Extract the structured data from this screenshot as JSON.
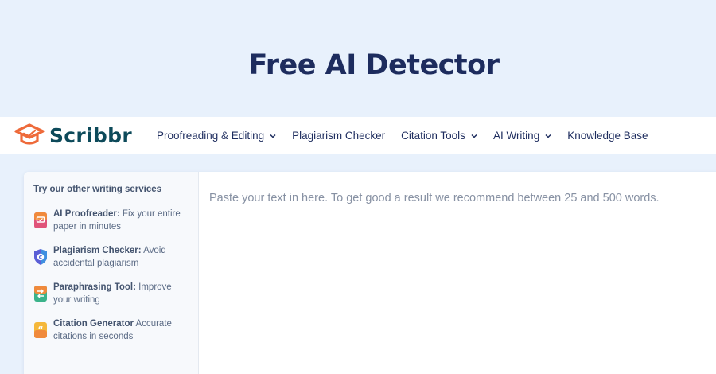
{
  "hero": {
    "title": "Free AI Detector"
  },
  "brand": {
    "name": "Scribbr",
    "colors": {
      "logo_orange": "#ee6a3a",
      "logo_teal": "#0d4a5a",
      "navy": "#1d2c5e",
      "background": "#e8f1fc"
    }
  },
  "nav": {
    "items": [
      {
        "label": "Proofreading & Editing",
        "has_dropdown": true
      },
      {
        "label": "Plagiarism Checker",
        "has_dropdown": false
      },
      {
        "label": "Citation Tools",
        "has_dropdown": true
      },
      {
        "label": "AI Writing",
        "has_dropdown": true
      },
      {
        "label": "Knowledge Base",
        "has_dropdown": false
      }
    ]
  },
  "sidebar": {
    "title": "Try our other writing services",
    "services": [
      {
        "name": "AI Proofreader:",
        "desc": "Fix your entire paper in minutes",
        "icon": "proofreader-icon"
      },
      {
        "name": "Plagiarism Checker:",
        "desc": "Avoid accidental plagiarism",
        "icon": "plagiarism-shield-icon"
      },
      {
        "name": "Paraphrasing Tool:",
        "desc": "Improve your writing",
        "icon": "paraphrase-icon"
      },
      {
        "name": "Citation Generator",
        "desc": "Accurate citations in seconds",
        "icon": "citation-quote-icon"
      }
    ]
  },
  "editor": {
    "placeholder": "Paste your text in here. To get good a result we recommend between 25 and 500 words."
  }
}
